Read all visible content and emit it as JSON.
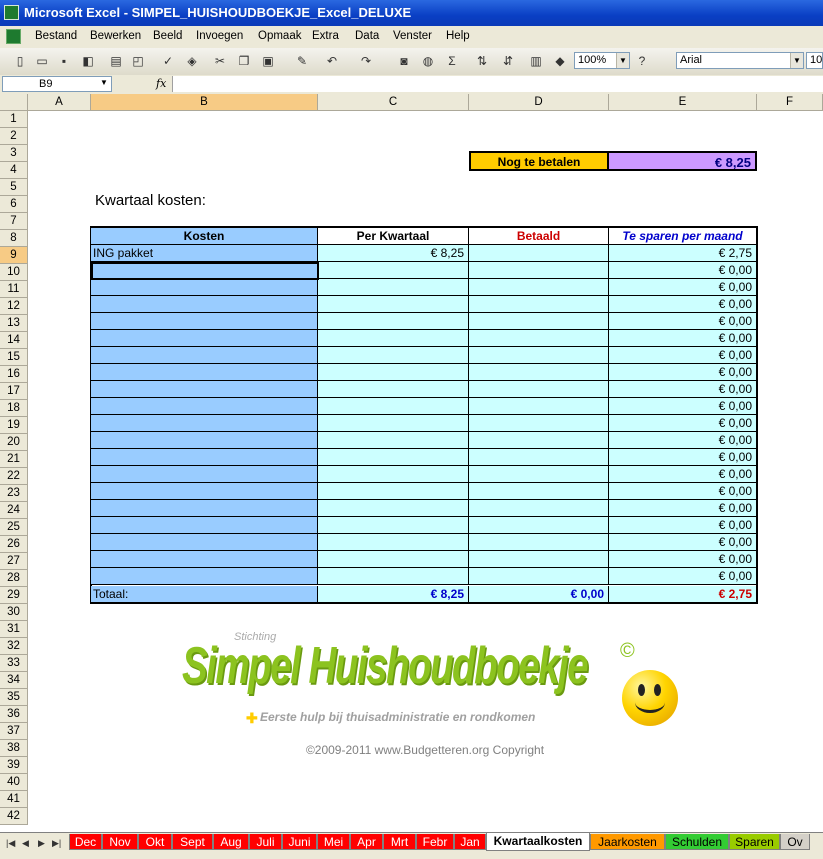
{
  "window": {
    "title": "Microsoft Excel - SIMPEL_HUISHOUDBOEKJE_Excel_DELUXE"
  },
  "menu": [
    "Bestand",
    "Bewerken",
    "Beeld",
    "Invoegen",
    "Opmaak",
    "Extra",
    "Data",
    "Venster",
    "Help"
  ],
  "toolbar": {
    "zoom": "100%",
    "font": "Arial",
    "size": "10",
    "sigma": "Σ"
  },
  "formula": {
    "namebox": "B9",
    "fx": "fx",
    "content": ""
  },
  "columns": [
    "A",
    "B",
    "C",
    "D",
    "E",
    "F"
  ],
  "selected": {
    "column": "B",
    "row": "9"
  },
  "rows": [
    "1",
    "2",
    "3",
    "4",
    "5",
    "6",
    "7",
    "8",
    "9",
    "10",
    "11",
    "12",
    "13",
    "14",
    "15",
    "16",
    "17",
    "18",
    "19",
    "20",
    "21",
    "22",
    "23",
    "24",
    "25",
    "26",
    "27",
    "28",
    "29",
    "30",
    "31",
    "32",
    "33",
    "34",
    "35",
    "36",
    "37",
    "38",
    "39",
    "40",
    "41",
    "42"
  ],
  "sheet": {
    "nog_label": "Nog te betalen",
    "nog_value": "€ 8,25",
    "section_title": "Kwartaal kosten:",
    "headers": {
      "kosten": "Kosten",
      "per_kwartaal": "Per Kwartaal",
      "betaald": "Betaald",
      "te_sparen": "Te sparen per maand"
    },
    "first_row": {
      "name": "ING pakket",
      "per_kwartaal": "€ 8,25",
      "te_sparen": "€ 2,75"
    },
    "empty_te_sparen": [
      "€ 0,00",
      "€ 0,00",
      "€ 0,00",
      "€ 0,00",
      "€ 0,00",
      "€ 0,00",
      "€ 0,00",
      "€ 0,00",
      "€ 0,00",
      "€ 0,00",
      "€ 0,00",
      "€ 0,00",
      "€ 0,00",
      "€ 0,00",
      "€ 0,00",
      "€ 0,00",
      "€ 0,00",
      "€ 0,00",
      "€ 0,00"
    ],
    "totals": {
      "label": "Totaal:",
      "per_kwartaal": "€ 8,25",
      "betaald": "€ 0,00",
      "te_sparen": "€ 2,75"
    },
    "logo_small": "Stichting",
    "logo_main": "Simpel Huishoudboekje",
    "logo_copy": "©",
    "logo_tagline": "Eerste hulp bij thuisadministratie en rondkomen",
    "copyright": "©2009-2011 www.Budgetteren.org Copyright"
  },
  "colors": {
    "header_bg": "#99ccff",
    "cell_bg": "#ccffff",
    "nog_label_bg": "#ffcc00",
    "nog_value_bg": "#cc99ff",
    "betaald_red": "#cc0000",
    "sparen_blue": "#0000cc",
    "logo_green": "#8cc31f"
  },
  "tabs": [
    {
      "label": "Dec",
      "color": "#ff0000"
    },
    {
      "label": "Nov",
      "color": "#ff0000"
    },
    {
      "label": "Okt",
      "color": "#ff0000"
    },
    {
      "label": "Sept",
      "color": "#ff0000"
    },
    {
      "label": "Aug",
      "color": "#ff0000"
    },
    {
      "label": "Juli",
      "color": "#ff0000"
    },
    {
      "label": "Juni",
      "color": "#ff0000"
    },
    {
      "label": "Mei",
      "color": "#ff0000"
    },
    {
      "label": "Apr",
      "color": "#ff0000"
    },
    {
      "label": "Mrt",
      "color": "#ff0000"
    },
    {
      "label": "Febr",
      "color": "#ff0000"
    },
    {
      "label": "Jan",
      "color": "#ff0000"
    },
    {
      "label": "Kwartaalkosten",
      "color": "#ffffff"
    },
    {
      "label": "Jaarkosten",
      "color": "#ff9900"
    },
    {
      "label": "Schulden",
      "color": "#33cc33"
    },
    {
      "label": "Sparen",
      "color": "#99cc00"
    },
    {
      "label": "Ov",
      "color": "#d4d0c8"
    }
  ]
}
